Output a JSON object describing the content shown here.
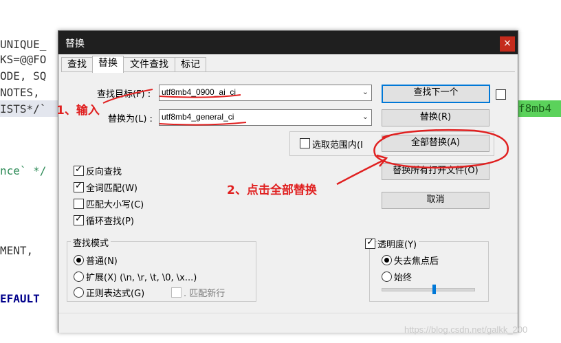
{
  "background_code": {
    "lines": [
      "UNIQUE_",
      "KS=@@FO",
      "ODE, SQ",
      "NOTES,",
      "ISTS*/`",
      "nce` */",
      "MENT,",
      "EFAULT"
    ],
    "right_highlight": "f8mb4"
  },
  "dialog": {
    "title": "替换",
    "close_icon": "×",
    "tabs": [
      "查找",
      "替换",
      "文件查找",
      "标记"
    ],
    "active_tab": "替换",
    "find_label": "查找目标(F) :",
    "find_value": "utf8mb4_0900_ai_ci",
    "replace_label": "替换为(L) :",
    "replace_value": "utf8mb4_general_ci",
    "buttons": {
      "find_next": "查找下一个",
      "replace": "替换(R)",
      "replace_all": "全部替换(A)",
      "replace_all_open": "替换所有打开文件(O)",
      "cancel": "取消"
    },
    "in_selection": "选取范围内(I",
    "options": [
      {
        "label": "反向查找",
        "checked": true
      },
      {
        "label": "全词匹配(W)",
        "checked": true
      },
      {
        "label": "匹配大小写(C)",
        "checked": false
      },
      {
        "label": "循环查找(P)",
        "checked": true
      }
    ],
    "search_mode": {
      "title": "查找模式",
      "normal": "普通(N)",
      "extended": "扩展(X) (\\n, \\r, \\t, \\0, \\x...)",
      "regex": "正则表达式(G)",
      "dot_newline": ". 匹配新行",
      "selected": "normal"
    },
    "transparency": {
      "title": "透明度(Y)",
      "checked": true,
      "on_lose_focus": "失去焦点后",
      "always": "始终",
      "selected": "on_lose_focus",
      "level": 0.55
    }
  },
  "annotations": {
    "step1": "1、输入",
    "step2": "2、点击全部替换"
  },
  "watermark": "https://blog.csdn.net/galkk_200",
  "colors": {
    "title_bar": "#1f1f1f",
    "close_button": "#c42b1c",
    "annotation": "#e02020",
    "accent": "#0078d7",
    "code_highlight": "#5bd25b"
  }
}
